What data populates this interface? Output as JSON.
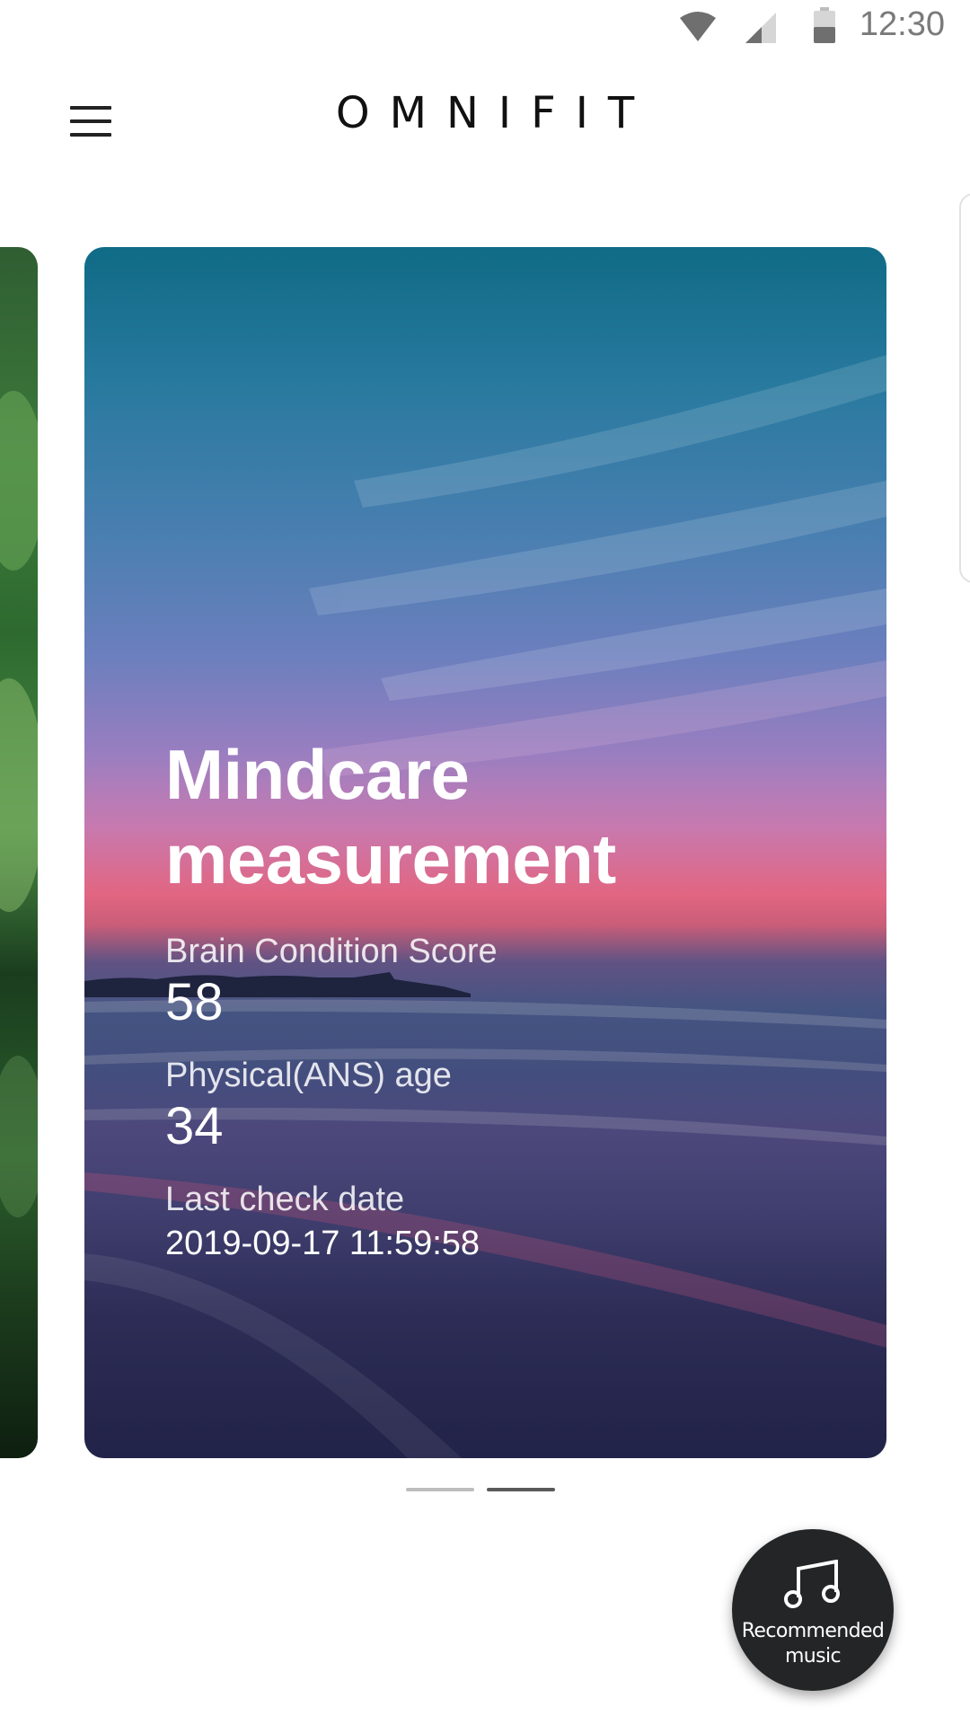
{
  "status_bar": {
    "time": "12:30",
    "icons": [
      "wifi-icon",
      "cellular-signal-icon",
      "battery-icon"
    ]
  },
  "header": {
    "title": "OMNIFIT",
    "menu_icon": "hamburger-menu-icon"
  },
  "carousel": {
    "active_index": 1,
    "page_count": 2,
    "cards": [
      {
        "title": "Mindcare measurement",
        "title_line1": "Mindcare",
        "title_line2": "measurement",
        "brain_score_label": "Brain Condition Score",
        "brain_score_value": "58",
        "physical_age_label": "Physical(ANS) age",
        "physical_age_value": "34",
        "last_check_label": "Last check date",
        "last_check_value": "2019-09-17 11:59:58"
      }
    ]
  },
  "fab": {
    "label": "Recommended music",
    "icon": "music-note-icon"
  },
  "colors": {
    "fab_background": "#232526",
    "indicator_active": "#5a5a5a",
    "indicator_inactive": "#bdbdbd"
  }
}
